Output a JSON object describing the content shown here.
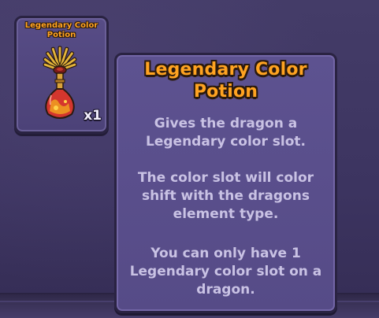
{
  "item_card": {
    "title_line1": "Legendary Color",
    "title_line2": "Potion",
    "quantity": "x1",
    "icon": "color-potion-icon"
  },
  "tooltip": {
    "title_line1": "Legendary Color",
    "title_line2": "Potion",
    "p1_line1": "Gives the dragon a",
    "p1_line2": "Legendary color slot.",
    "p2_line1": "The color slot will color",
    "p2_line2": "shift with the dragons",
    "p2_line3": "element type.",
    "p3_line1": "You can only have 1",
    "p3_line2": "Legendary color slot on a",
    "p3_line3": "dragon."
  },
  "colors": {
    "title_orange": "#ffa321",
    "panel_purple": "#5d5290",
    "body_text": "#c9c2e4",
    "outline": "#2a2342"
  }
}
